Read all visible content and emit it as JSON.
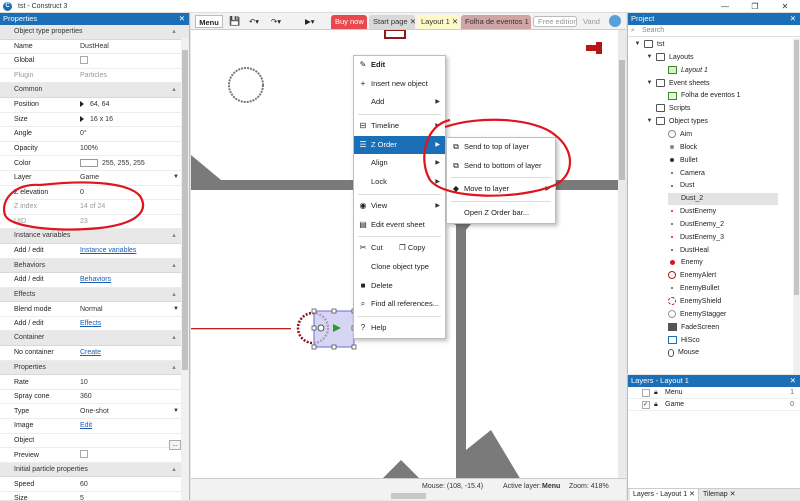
{
  "window": {
    "title": "tst - Construct 3"
  },
  "properties": {
    "header": "Properties",
    "rows": [
      {
        "kind": "cat",
        "label": "Object type properties"
      },
      {
        "kind": "row",
        "key": "Name",
        "value": "DustHeal"
      },
      {
        "kind": "row",
        "key": "Global",
        "value": "",
        "control": "checkbox"
      },
      {
        "kind": "row",
        "key": "Plugin",
        "value": "Particles",
        "dim": true
      },
      {
        "kind": "cat",
        "label": "Common"
      },
      {
        "kind": "row",
        "key": "Position",
        "value": "64, 64",
        "control": "expand"
      },
      {
        "kind": "row",
        "key": "Size",
        "value": "16 x 16",
        "control": "expand"
      },
      {
        "kind": "row",
        "key": "Angle",
        "value": "0°"
      },
      {
        "kind": "row",
        "key": "Opacity",
        "value": "100%"
      },
      {
        "kind": "row",
        "key": "Color",
        "value": "255, 255, 255",
        "control": "swatch"
      },
      {
        "kind": "row",
        "key": "Layer",
        "value": "Game",
        "control": "dropdown"
      },
      {
        "kind": "row",
        "key": "Z elevation",
        "value": "0"
      },
      {
        "kind": "row",
        "key": "Z index",
        "value": "14 of 24",
        "dim": true
      },
      {
        "kind": "row",
        "key": "UID",
        "value": "23",
        "dim": true
      },
      {
        "kind": "cat",
        "label": "Instance variables"
      },
      {
        "kind": "row",
        "key": "Add / edit",
        "value": "Instance variables",
        "link": true
      },
      {
        "kind": "cat",
        "label": "Behaviors"
      },
      {
        "kind": "row",
        "key": "Add / edit",
        "value": "Behaviors",
        "link": true
      },
      {
        "kind": "cat",
        "label": "Effects"
      },
      {
        "kind": "row",
        "key": "Blend mode",
        "value": "Normal",
        "control": "dropdown"
      },
      {
        "kind": "row",
        "key": "Add / edit",
        "value": "Effects",
        "link": true
      },
      {
        "kind": "cat",
        "label": "Container"
      },
      {
        "kind": "row",
        "key": "No container",
        "value": "Create",
        "link": true
      },
      {
        "kind": "cat",
        "label": "Properties"
      },
      {
        "kind": "row",
        "key": "Rate",
        "value": "10"
      },
      {
        "kind": "row",
        "key": "Spray cone",
        "value": "360"
      },
      {
        "kind": "row",
        "key": "Type",
        "value": "One-shot",
        "control": "dropdown"
      },
      {
        "kind": "row",
        "key": "Image",
        "value": "Edit",
        "link": true
      },
      {
        "kind": "row",
        "key": "Object",
        "value": "",
        "control": "dots"
      },
      {
        "kind": "row",
        "key": "Preview",
        "value": "",
        "control": "checkbox"
      },
      {
        "kind": "cat",
        "label": "Initial particle properties"
      },
      {
        "kind": "row",
        "key": "Speed",
        "value": "60"
      },
      {
        "kind": "row",
        "key": "Size",
        "value": "5"
      }
    ]
  },
  "toolbar": {
    "menu_label": "Menu",
    "tabs": [
      {
        "label": "Buy now",
        "style": "buy"
      },
      {
        "label": "Start page",
        "style": "plain"
      },
      {
        "label": "Layout 1",
        "style": "active"
      },
      {
        "label": "Folha de eventos 1",
        "style": "events"
      },
      {
        "label": "Free edition",
        "style": "free"
      },
      {
        "label": "Vand",
        "style": "user"
      }
    ]
  },
  "context_menu": {
    "items": [
      {
        "label": "Edit",
        "icon": "pencil-icon",
        "bold": true
      },
      {
        "label": "Insert new object",
        "icon": "plus-icon"
      },
      {
        "label": "Add",
        "icon": "",
        "submenu": true
      },
      {
        "sep": true
      },
      {
        "label": "Timeline",
        "icon": "timeline-icon",
        "submenu": true
      },
      {
        "label": "Z Order",
        "icon": "list-icon",
        "submenu": true,
        "highlight": true
      },
      {
        "label": "Align",
        "icon": "",
        "submenu": true
      },
      {
        "label": "Lock",
        "icon": "",
        "submenu": true
      },
      {
        "sep": true
      },
      {
        "label": "View",
        "icon": "eye-icon",
        "submenu": true
      },
      {
        "label": "Edit event sheet",
        "icon": "event-sheet-icon"
      },
      {
        "sep": true
      },
      {
        "label": "Cut",
        "icon": "scissors-icon"
      },
      {
        "label": "Clone object type",
        "icon": ""
      },
      {
        "label": "Delete",
        "icon": "delete-icon"
      },
      {
        "label": "Find all references...",
        "icon": "search-icon"
      },
      {
        "sep": true
      },
      {
        "label": "Help",
        "icon": "help-icon"
      }
    ],
    "copy_label": "Copy"
  },
  "zorder_menu": {
    "items": [
      {
        "label": "Send to top of layer",
        "icon": "send-top-icon"
      },
      {
        "label": "Send to bottom of layer",
        "icon": "send-bottom-icon"
      },
      {
        "sep": true
      },
      {
        "label": "Move to layer",
        "icon": "layers-icon",
        "submenu": true
      },
      {
        "sep": true
      },
      {
        "label": "Open Z Order bar...",
        "icon": ""
      }
    ]
  },
  "status": {
    "mouse": "Mouse: (108, -15.4)",
    "active_layer_label": "Active layer:",
    "active_layer": "Menu",
    "zoom": "Zoom: 418%"
  },
  "project": {
    "header": "Project",
    "search_placeholder": "Search",
    "tree": [
      {
        "label": "tst",
        "depth": 0,
        "icon": "folder",
        "twisty": "open"
      },
      {
        "label": "Layouts",
        "depth": 1,
        "icon": "folder",
        "twisty": "open"
      },
      {
        "label": "Layout 1",
        "depth": 2,
        "icon": "layout",
        "italic": true
      },
      {
        "label": "Event sheets",
        "depth": 1,
        "icon": "folder",
        "twisty": "open"
      },
      {
        "label": "Folha de eventos 1",
        "depth": 2,
        "icon": "events"
      },
      {
        "label": "Scripts",
        "depth": 1,
        "icon": "folder"
      },
      {
        "label": "Object types",
        "depth": 1,
        "icon": "folder",
        "twisty": "open"
      },
      {
        "label": "Aim",
        "depth": 2,
        "icon": "circle-outline"
      },
      {
        "label": "Block",
        "depth": 2,
        "icon": "dot-gray"
      },
      {
        "label": "Bullet",
        "depth": 2,
        "icon": "dot-dark"
      },
      {
        "label": "Camera",
        "depth": 2,
        "icon": "dot-small"
      },
      {
        "label": "Dust",
        "depth": 2,
        "icon": "dot-small"
      },
      {
        "label": "Dust_2",
        "depth": 2,
        "icon": "none",
        "selected": true
      },
      {
        "label": "DustEnemy",
        "depth": 2,
        "icon": "dot-red"
      },
      {
        "label": "DustEnemy_2",
        "depth": 2,
        "icon": "dot-small"
      },
      {
        "label": "DustEnemy_3",
        "depth": 2,
        "icon": "dot-red"
      },
      {
        "label": "DustHeal",
        "depth": 2,
        "icon": "dot-small"
      },
      {
        "label": "Enemy",
        "depth": 2,
        "icon": "dot-red-big"
      },
      {
        "label": "EnemyAlert",
        "depth": 2,
        "icon": "circle-red"
      },
      {
        "label": "EnemyBullet",
        "depth": 2,
        "icon": "dot-small"
      },
      {
        "label": "EnemyShield",
        "depth": 2,
        "icon": "circle-red-dash"
      },
      {
        "label": "EnemyStagger",
        "depth": 2,
        "icon": "circle-gray"
      },
      {
        "label": "FadeScreen",
        "depth": 2,
        "icon": "square-dark"
      },
      {
        "label": "HiSco",
        "depth": 2,
        "icon": "hisco"
      },
      {
        "label": "Mouse",
        "depth": 2,
        "icon": "mouse"
      }
    ]
  },
  "layers": {
    "header": "Layers - Layout 1",
    "rows": [
      {
        "name": "Menu",
        "index": "1",
        "checked": false
      },
      {
        "name": "Game",
        "index": "0",
        "checked": true
      }
    ],
    "tabs": [
      {
        "label": "Layers - Layout 1"
      },
      {
        "label": "Tilemap"
      }
    ]
  },
  "colors": {
    "accent": "#1b6fb7",
    "annotation": "#e0141e",
    "buy": "#e8494f",
    "layout_tab": "#fff8c7",
    "events_tab": "#cfa5a5"
  }
}
